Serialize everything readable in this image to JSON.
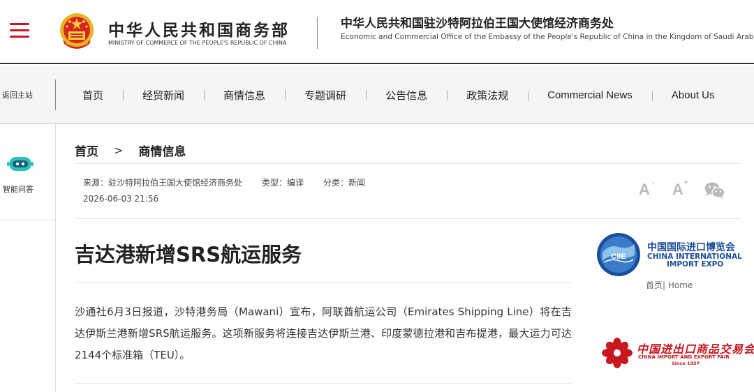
{
  "header": {
    "ministry_cn": "中华人民共和国商务部",
    "ministry_en": "MINISTRY OF COMMERCE OF THE PEOPLE'S REPUBLIC OF CHINA",
    "office_cn": "中华人民共和国驻沙特阿拉伯王国大使馆经济商务处",
    "office_en": "Economic and Commercial Office of the Embassy of the People's Republic of China in the Kingdom of Saudi Arabia",
    "brand_color": "#c8171e"
  },
  "nav": {
    "back_home": "返回主站",
    "items": [
      {
        "label": "首页"
      },
      {
        "label": "经贸新闻"
      },
      {
        "label": "商情信息"
      },
      {
        "label": "专题调研"
      },
      {
        "label": "公告信息"
      },
      {
        "label": "政策法规"
      },
      {
        "label": "Commercial News"
      },
      {
        "label": "About Us"
      }
    ]
  },
  "sidebar_left": {
    "ai_label": "智能问答"
  },
  "breadcrumb": {
    "items": [
      {
        "label": "首页"
      },
      {
        "label": "商情信息"
      }
    ],
    "separator": ">"
  },
  "meta": {
    "source": "来源：驻沙特阿拉伯王国大使馆经济商务处",
    "type": "类型：编译",
    "category": "分类：新闻",
    "date": "2026-06-03 21:56"
  },
  "tools": {
    "font_small": "A",
    "font_small_sup": "-",
    "font_large": "A",
    "font_large_sup": "+",
    "wechat_icon": "wechat-icon"
  },
  "article": {
    "title": "吉达港新增SRS航运服务",
    "body": "沙通社6月3日报道，沙特港务局（Mawani）宣布，阿联酋航运公司（Emirates Shipping Line）将在吉达伊斯兰港新增SRS航运服务。这项新服务将连接吉达伊斯兰港、印度蒙德拉港和吉布提港，最大运力可达2144个标准箱（TEU）。"
  },
  "sidebar_right": {
    "ciie_cn": "中国国际进口博览会",
    "ciie_en_1": "CHINA INTERNATIONAL",
    "ciie_en_2": "IMPORT EXPO",
    "ciie_logo_text": "CIIE",
    "ciie_home": "首页| Home",
    "canton_cn": "中国进出口商品交易会",
    "canton_en": "CHINA IMPORT AND EXPORT FAIR",
    "canton_since": "Since 1957"
  }
}
